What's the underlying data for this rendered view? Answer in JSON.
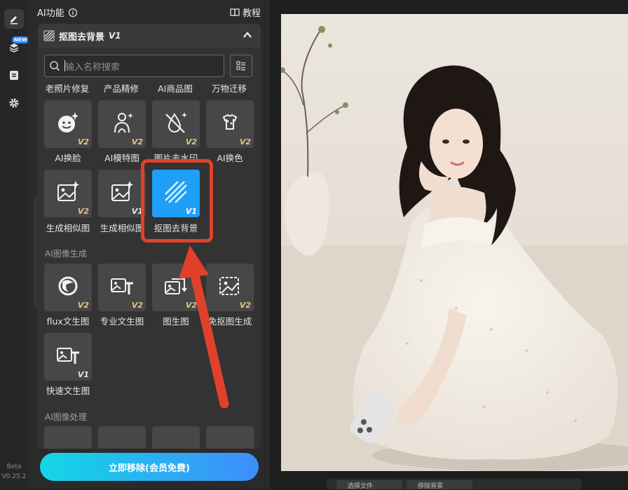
{
  "rail": {
    "new_badge": "NEW",
    "beta": "Beta",
    "version": "V0.25.2"
  },
  "panel": {
    "title": "AI功能",
    "tutorial": "教程"
  },
  "popup": {
    "title": "抠图去背景",
    "title_version": "V1",
    "search_placeholder": "输入名称搜索",
    "top_row": [
      "老照片修复",
      "产品精修",
      "AI商品图",
      "万物迁移"
    ],
    "row1": [
      {
        "label": "AI换脸",
        "version": "V2",
        "icon": "face-smile-sparkle-icon"
      },
      {
        "label": "AI模特图",
        "version": "V2",
        "icon": "model-person-icon"
      },
      {
        "label": "图片去水印",
        "version": "V2",
        "icon": "droplet-remove-icon"
      },
      {
        "label": "AI换色",
        "version": "V2",
        "icon": "palette-shirt-icon"
      }
    ],
    "row2": [
      {
        "label": "生成相似图",
        "version": "V2",
        "icon": "image-sparkle-icon"
      },
      {
        "label": "生成相似图",
        "version": "V1",
        "icon": "image-sparkle-icon"
      },
      {
        "label": "抠图去背景",
        "version": "V1",
        "icon": "diagonal-stripes-icon",
        "selected": true
      }
    ],
    "section_gen": "AI图像生成",
    "row3": [
      {
        "label": "flux文生图",
        "version": "V2",
        "icon": "flux-swirl-icon"
      },
      {
        "label": "专业文生图",
        "version": "V2",
        "icon": "image-text-icon"
      },
      {
        "label": "图生图",
        "version": "V2",
        "icon": "image-to-image-icon"
      },
      {
        "label": "免抠图生成",
        "version": "V2",
        "icon": "image-cutout-icon"
      }
    ],
    "row4": [
      {
        "label": "快速文生图",
        "version": "V1",
        "icon": "image-text-icon"
      }
    ],
    "section_proc": "AI图像处理"
  },
  "cta": {
    "label": "立即移除(会员免费)"
  },
  "bottom_bar": {
    "item1": "选择文件",
    "item2": "移除背景"
  },
  "colors": {
    "accent": "#1f9ff7",
    "highlight": "#e0412b",
    "version_gold": "#e7c47e"
  }
}
